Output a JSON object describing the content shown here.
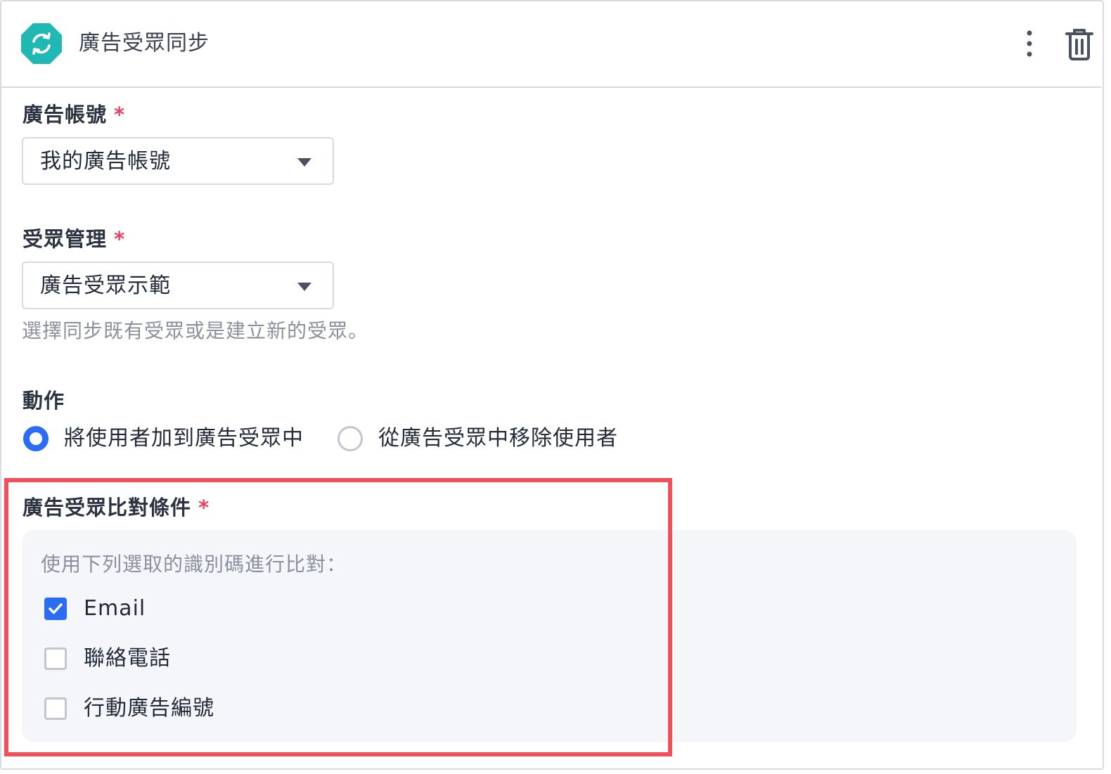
{
  "header": {
    "title": "廣告受眾同步",
    "app_icon": "sync-icon",
    "more_icon": "more-vertical-icon",
    "delete_icon": "trash-icon",
    "accent_color": "#1fb8b3"
  },
  "ad_account": {
    "label": "廣告帳號",
    "required_mark": "*",
    "value": "我的廣告帳號"
  },
  "audience_management": {
    "label": "受眾管理",
    "required_mark": "*",
    "value": "廣告受眾示範",
    "helper": "選擇同步既有受眾或是建立新的受眾。"
  },
  "action": {
    "label": "動作",
    "options": [
      {
        "label": "將使用者加到廣告受眾中",
        "selected": true
      },
      {
        "label": "從廣告受眾中移除使用者",
        "selected": false
      }
    ]
  },
  "matching": {
    "label": "廣告受眾比對條件",
    "required_mark": "*",
    "hint": "使用下列選取的識別碼進行比對：",
    "identifiers": [
      {
        "label": "Email",
        "checked": true
      },
      {
        "label": "聯絡電話",
        "checked": false
      },
      {
        "label": "行動廣告編號",
        "checked": false
      }
    ]
  },
  "colors": {
    "primary": "#2a6df4",
    "required": "#ef3e63",
    "highlight": "#f0505a",
    "panel_bg": "#f4f6fa"
  }
}
